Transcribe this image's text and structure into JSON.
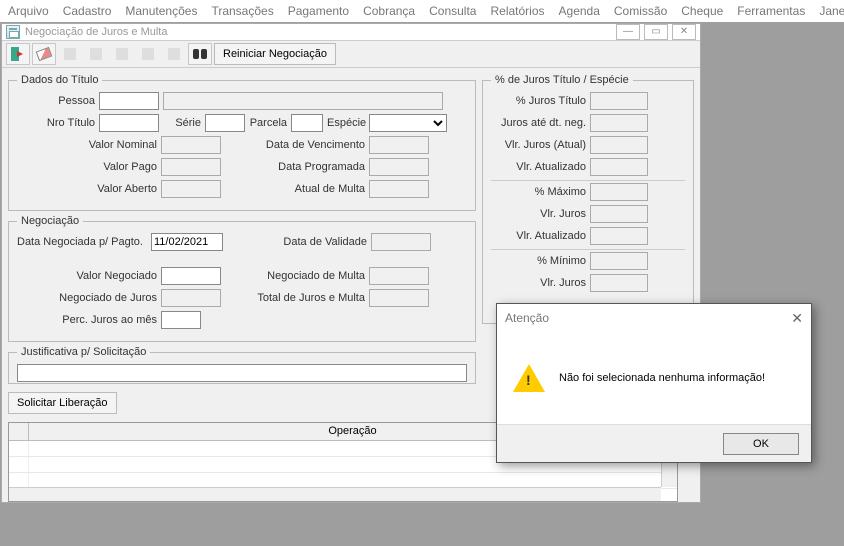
{
  "menu": [
    "Arquivo",
    "Cadastro",
    "Manutenções",
    "Transações",
    "Pagamento",
    "Cobrança",
    "Consulta",
    "Relatórios",
    "Agenda",
    "Comissão",
    "Cheque",
    "Ferramentas",
    "Janela"
  ],
  "window": {
    "title": "Negociação de Juros e Multa",
    "reset_label": "Reiniciar Negociação"
  },
  "dados_titulo": {
    "legend": "Dados do Título",
    "pessoa_label": "Pessoa",
    "pessoa_value": "",
    "nro_titulo_label": "Nro Título",
    "nro_titulo_value": "",
    "serie_label": "Série",
    "serie_value": "",
    "parcela_label": "Parcela",
    "parcela_value": "",
    "especie_label": "Espécie",
    "especie_value": "",
    "valor_nominal_label": "Valor Nominal",
    "valor_nominal_value": "",
    "data_venc_label": "Data de Vencimento",
    "data_venc_value": "",
    "valor_pago_label": "Valor Pago",
    "valor_pago_value": "",
    "data_prog_label": "Data Programada",
    "data_prog_value": "",
    "valor_aberto_label": "Valor Aberto",
    "valor_aberto_value": "",
    "atual_multa_label": "Atual de Multa",
    "atual_multa_value": ""
  },
  "negociacao": {
    "legend": "Negociação",
    "data_neg_label": "Data Negociada p/ Pagto.",
    "data_neg_value": "11/02/2021",
    "data_val_label": "Data de Validade",
    "data_val_value": "",
    "valor_neg_label": "Valor Negociado",
    "valor_neg_value": "",
    "neg_multa_label": "Negociado de Multa",
    "neg_multa_value": "",
    "neg_juros_label": "Negociado de Juros",
    "neg_juros_value": "",
    "total_jm_label": "Total de Juros e Multa",
    "total_jm_value": "",
    "perc_juros_label": "Perc. Juros ao mês",
    "perc_juros_value": ""
  },
  "juros_especie": {
    "legend": "% de Juros Título / Espécie",
    "pct_titulo_label": "% Juros Título",
    "pct_titulo_value": "",
    "juros_dt_label": "Juros até dt. neg.",
    "juros_dt_value": "",
    "vlr_juros_atual_label": "Vlr. Juros (Atual)",
    "vlr_juros_atual_value": "",
    "vlr_atualizado_label": "Vlr. Atualizado",
    "vlr_atualizado_value": "",
    "pct_max_label": "% Máximo",
    "pct_max_value": "",
    "vlr_juros_max_label": "Vlr. Juros",
    "vlr_juros_max_value": "",
    "vlr_atu_max_label": "Vlr. Atualizado",
    "vlr_atu_max_value": "",
    "pct_min_label": "% Mínimo",
    "pct_min_value": "",
    "vlr_juros_min_label": "Vlr. Juros",
    "vlr_juros_min_value": ""
  },
  "justificativa": {
    "legend": "Justificativa p/ Solicitação",
    "value": ""
  },
  "solicitar_label": "Solicitar Liberação",
  "grid": {
    "col1": "",
    "col2": "Operação"
  },
  "dialog": {
    "title": "Atenção",
    "message": "Não foi selecionada nenhuma informação!",
    "ok_label": "OK"
  }
}
